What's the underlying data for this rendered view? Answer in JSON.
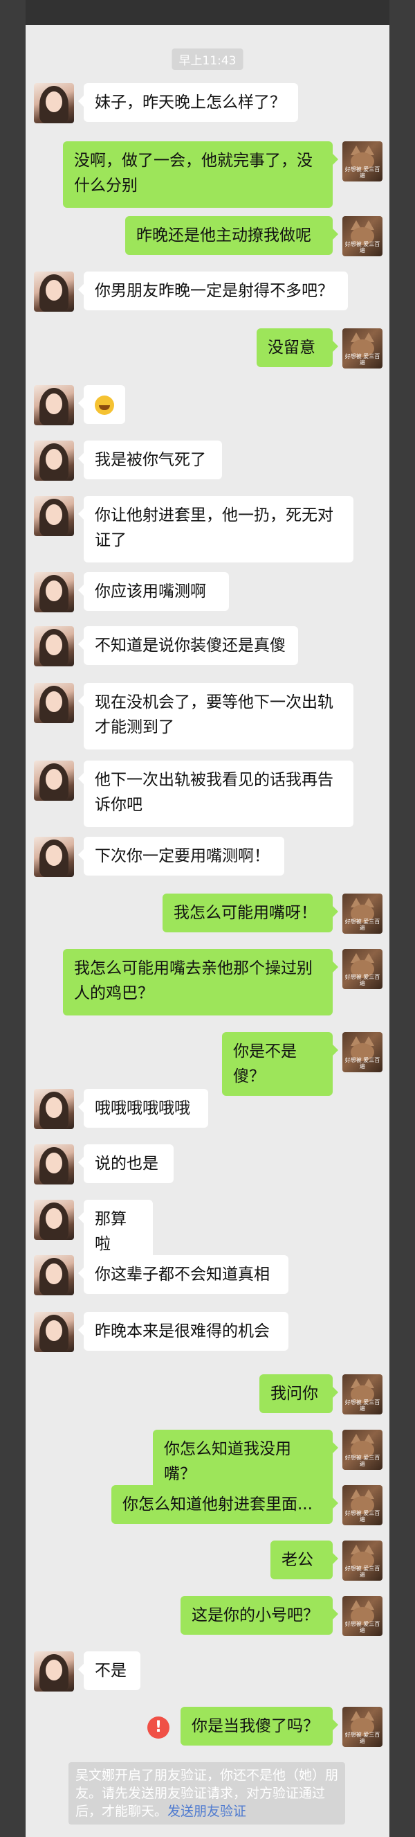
{
  "timestamp": "早上11:43",
  "messages": [
    {
      "side": "left",
      "text": "妹子，昨天晚上怎么样了？"
    },
    {
      "side": "right",
      "text": "没啊，做了一会，他就完事了，没什么分别"
    },
    {
      "side": "right",
      "text": "昨晚还是他主动撩我做呢"
    },
    {
      "side": "left",
      "text": "你男朋友昨晚一定是射得不多吧？"
    },
    {
      "side": "right",
      "text": "没留意"
    },
    {
      "side": "left",
      "text": "",
      "emoji": "grin-emoji"
    },
    {
      "side": "left",
      "text": "我是被你气死了"
    },
    {
      "side": "left",
      "text": "你让他射进套里，他一扔，死无对证了"
    },
    {
      "side": "left",
      "text": "你应该用嘴测啊"
    },
    {
      "side": "left",
      "text": "不知道是说你装傻还是真傻"
    },
    {
      "side": "left",
      "text": "现在没机会了，要等他下一次出轨才能测到了"
    },
    {
      "side": "left",
      "text": "他下一次出轨被我看见的话我再告诉你吧"
    },
    {
      "side": "left",
      "text": "下次你一定要用嘴测啊！"
    },
    {
      "side": "right",
      "text": "我怎么可能用嘴呀！"
    },
    {
      "side": "right",
      "text": "我怎么可能用嘴去亲他那个操过别人的鸡巴？"
    },
    {
      "side": "right",
      "text": "你是不是傻？"
    },
    {
      "side": "left",
      "text": "哦哦哦哦哦哦"
    },
    {
      "side": "left",
      "text": "说的也是"
    },
    {
      "side": "left",
      "text": "那算啦"
    },
    {
      "side": "left",
      "text": "你这辈子都不会知道真相"
    },
    {
      "side": "left",
      "text": "昨晚本来是很难得的机会"
    },
    {
      "side": "right",
      "text": "我问你"
    },
    {
      "side": "right",
      "text": "你怎么知道我没用嘴？"
    },
    {
      "side": "right",
      "text": "你怎么知道他射进套里面..."
    },
    {
      "side": "right",
      "text": "老公"
    },
    {
      "side": "right",
      "text": "这是你的小号吧？"
    },
    {
      "side": "left",
      "text": "不是"
    },
    {
      "side": "right",
      "text": "你是当我傻了吗？",
      "failed": true
    }
  ],
  "icons": {
    "left_avatar": "girl-avatar",
    "right_avatar": "cat-avatar",
    "failed": "exclamation-icon",
    "right_avatar_caption": "好想被\n爱三百遍"
  },
  "system_note": {
    "text": "吴文娜开启了朋友验证，你还不是他（她）朋友。请先发送朋友验证请求，对方验证通过后，才能聊天。",
    "link": "发送朋友验证"
  },
  "colors": {
    "background": "#ebebeb",
    "right_bubble": "#9de55a",
    "left_bubble": "#ffffff",
    "link": "#4f7bd0",
    "fail": "#f05046"
  }
}
